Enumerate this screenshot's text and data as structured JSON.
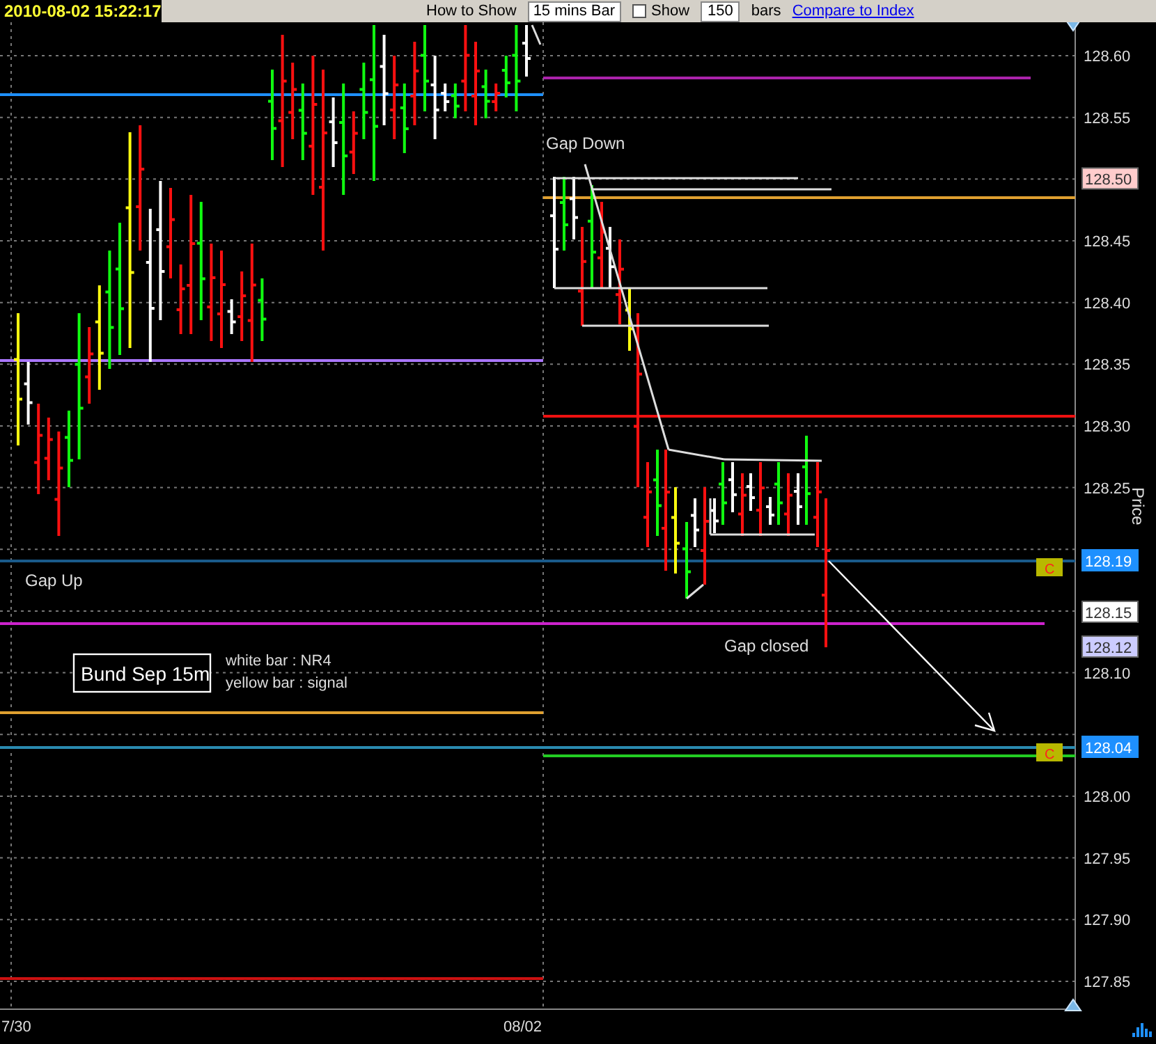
{
  "header": {
    "timestamp": "2010-08-02 15:22:17"
  },
  "toolbar": {
    "how_to_show_label": "How to Show",
    "bar_interval": "15 mins Bar",
    "show": {
      "label": "Show",
      "checked": false
    },
    "bar_count": "150",
    "bars_label": "bars",
    "compare_link": "Compare to Index"
  },
  "chart": {
    "price_axis": {
      "title": "Price",
      "ticks": [
        "128.60",
        "128.55",
        "128.45",
        "128.40",
        "128.35",
        "128.30",
        "128.25",
        "128.10",
        "128.00",
        "127.95",
        "127.90",
        "127.85"
      ]
    },
    "time_axis": [
      "7/30",
      "08/02"
    ],
    "price_tags": [
      {
        "text": "128.50",
        "color": "#ffcccc"
      },
      {
        "text": "128.19",
        "color": "#1e90ff"
      },
      {
        "text": "128.15",
        "color": "#ffffff"
      },
      {
        "text": "128.12",
        "color": "#ccccff"
      },
      {
        "text": "128.04",
        "color": "#1e90ff"
      }
    ],
    "close_markers": [
      "C",
      "C"
    ],
    "annotations": [
      {
        "kind": "label",
        "text": "Gap Down"
      },
      {
        "kind": "label",
        "text": "Gap Up"
      },
      {
        "kind": "label",
        "text": "Gap closed"
      }
    ],
    "legend": {
      "title": "Bund Sep 15m",
      "lines": [
        "white bar : NR4",
        "yellow bar : signal"
      ]
    }
  }
}
